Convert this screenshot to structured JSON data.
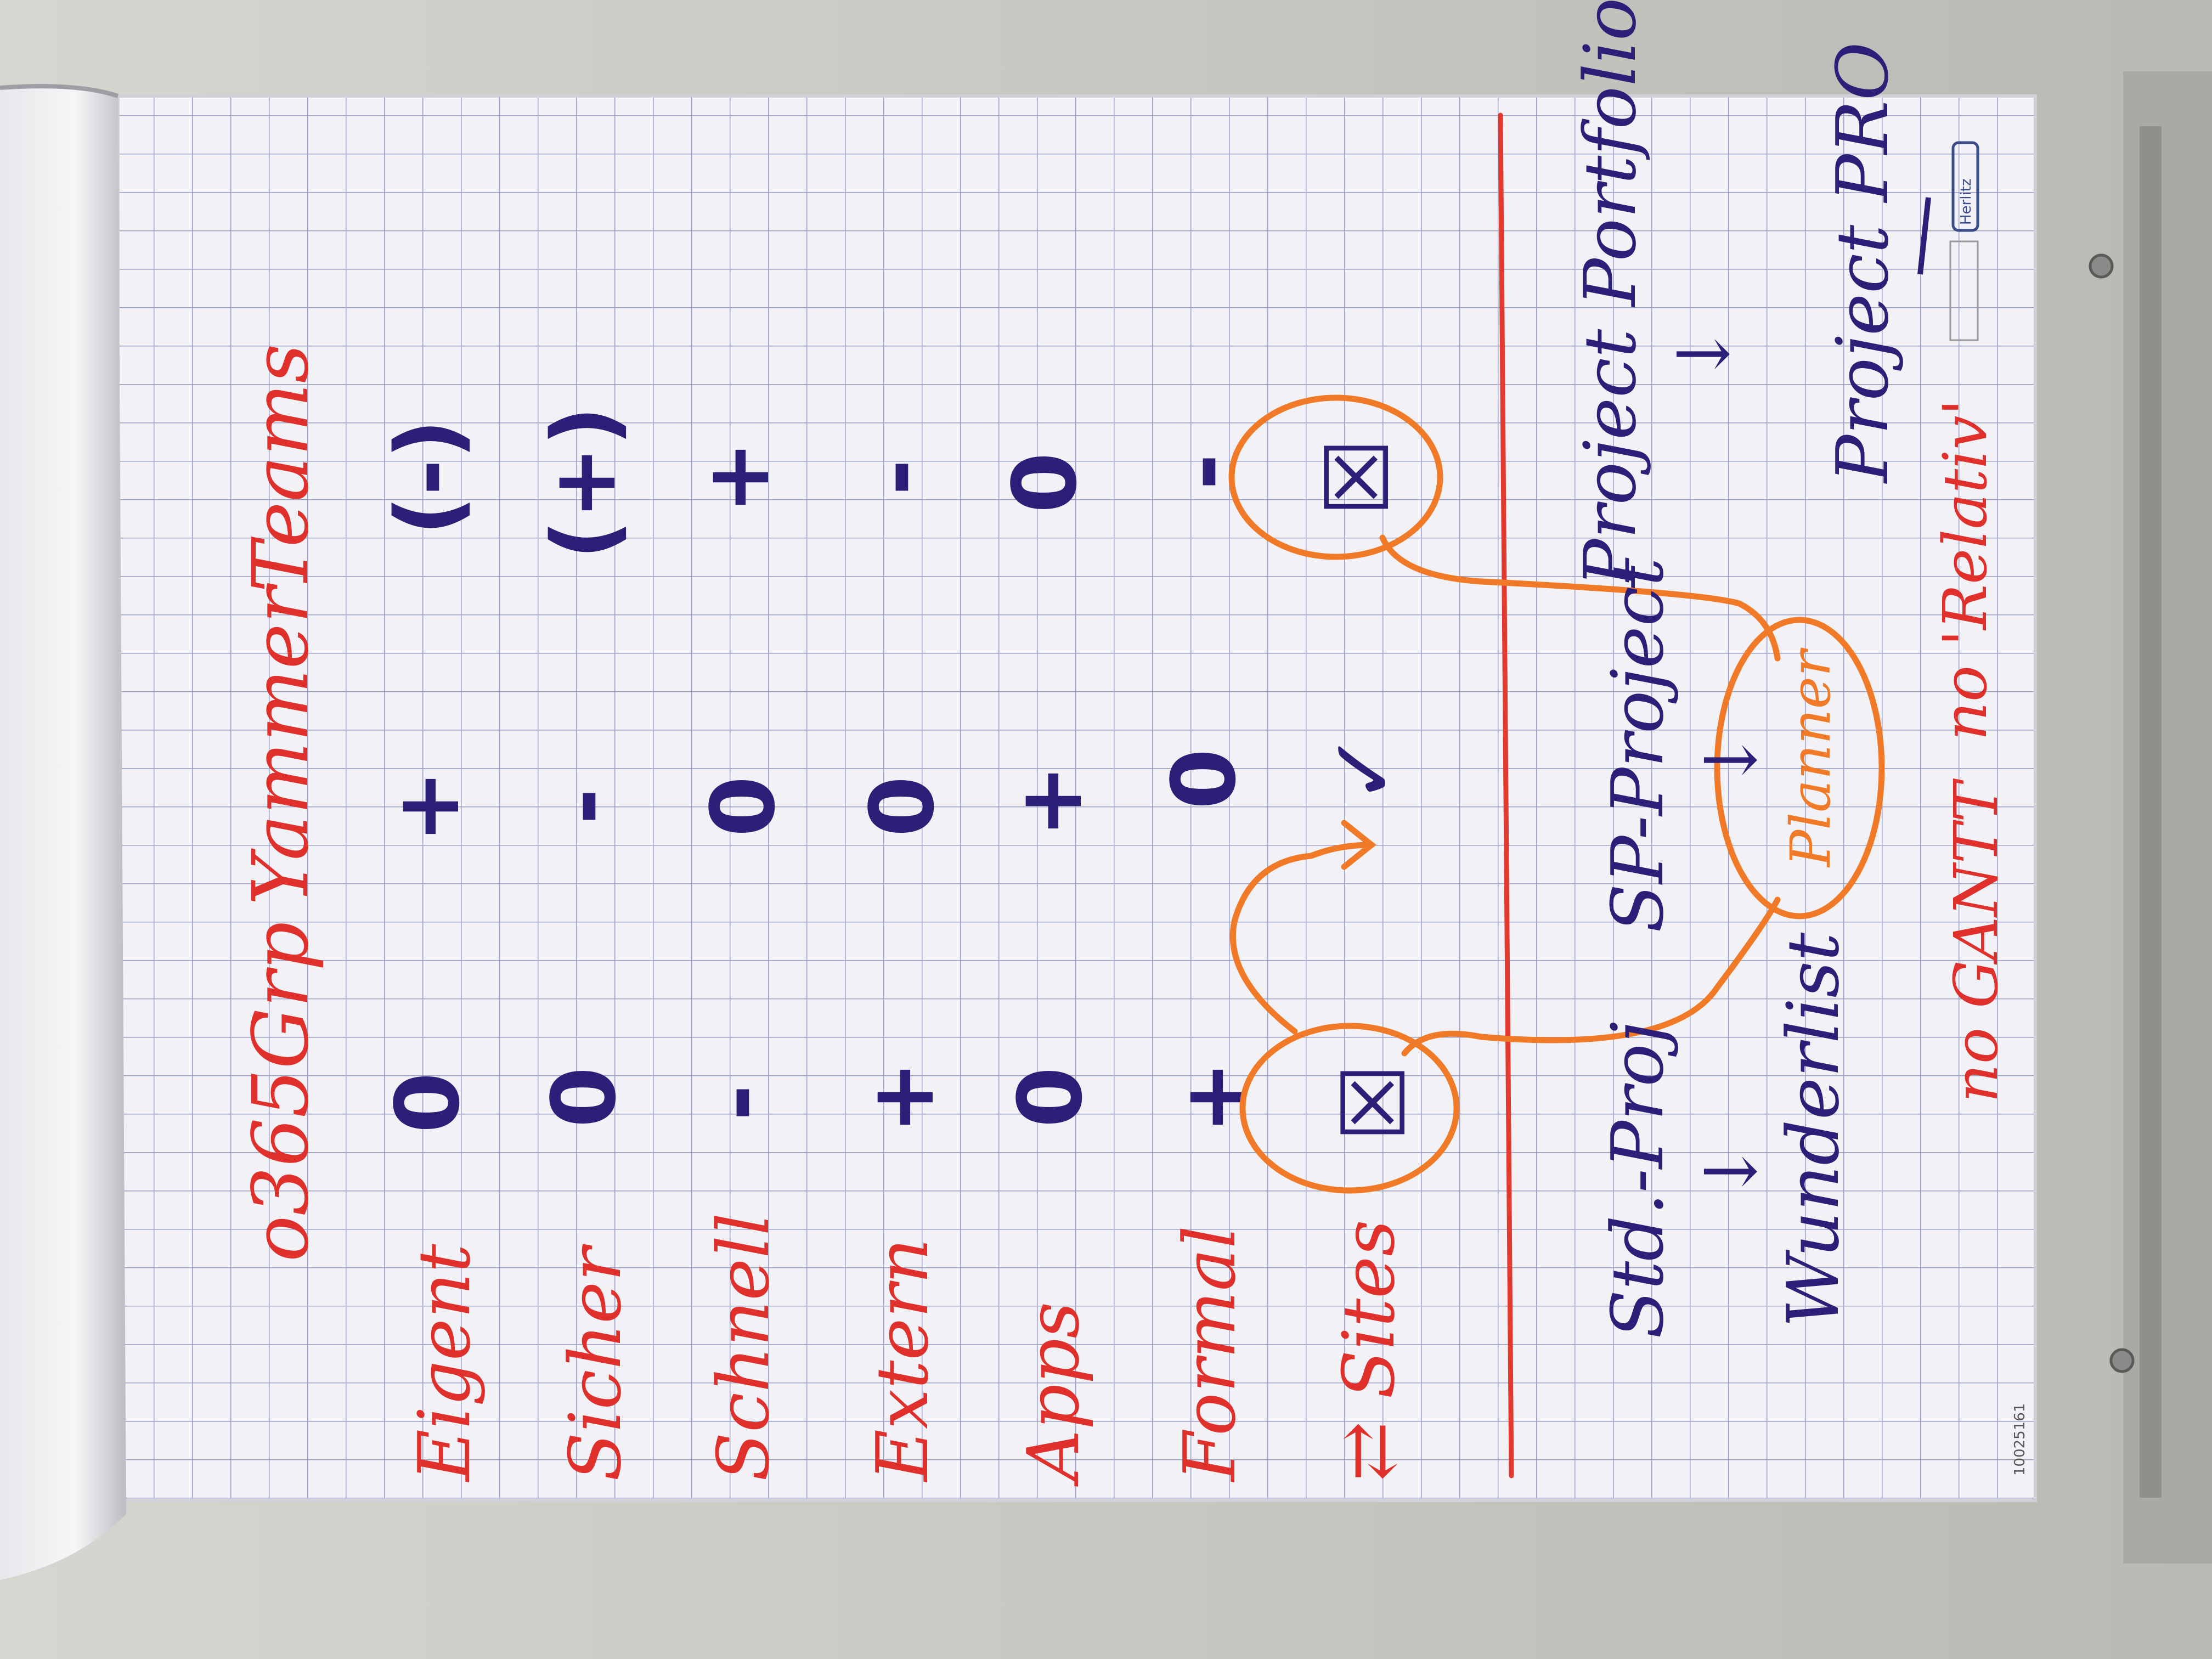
{
  "colors": {
    "paper": "#f2f2f6",
    "grid": "#9aa0c4",
    "red_marker": "#e0302c",
    "blue_marker": "#2c1f78",
    "orange_marker": "#f07a28",
    "margin_line": "#e23a2e"
  },
  "columns": [
    "o365Grp",
    "Yammer",
    "Teams"
  ],
  "rows": [
    {
      "label": "Eigent",
      "values": [
        "0",
        "+",
        "(-)"
      ]
    },
    {
      "label": "Sicher",
      "values": [
        "0",
        "-",
        "(+)"
      ]
    },
    {
      "label": "Schnell",
      "values": [
        "-",
        "0",
        "+"
      ]
    },
    {
      "label": "Extern",
      "values": [
        "+",
        "0",
        "-"
      ]
    },
    {
      "label": "Apps",
      "values": [
        "0",
        "+",
        "0"
      ]
    },
    {
      "label": "Formal",
      "values": [
        "+",
        "0",
        "-"
      ]
    },
    {
      "label": "⇄ Sites",
      "values": [
        "☒",
        "✓",
        "☒"
      ]
    }
  ],
  "bottom": {
    "left_top": "Std.-Proj",
    "left_arrow": "↓",
    "left_bottom": "Wunderlist",
    "middle_top": "SP-Project",
    "middle_arrow": "↓",
    "middle_bottom": "Planner",
    "right_top": "Project Portfolio",
    "right_arrow": "↓",
    "right_bottom": "Project PRO",
    "note_left": "no GANTT",
    "note_right": "no 'Relativ'"
  },
  "sheet_code": "10025161",
  "logo_text": "Herlitz"
}
